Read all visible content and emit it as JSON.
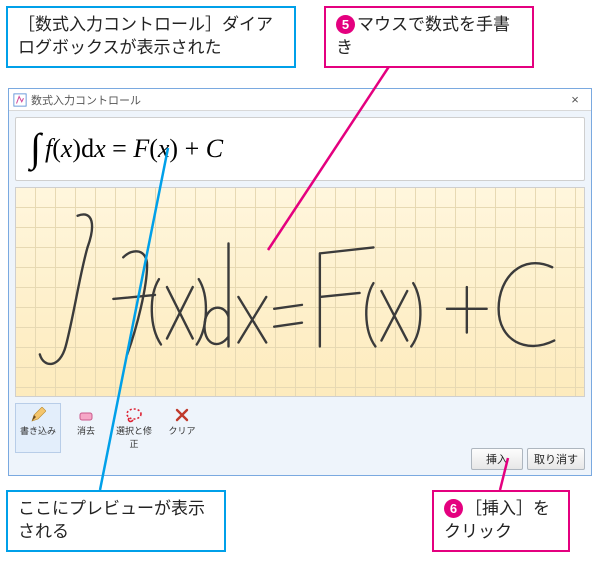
{
  "callouts": {
    "top_left": "［数式入力コントロール］ダイアログボックスが表示された",
    "top_right_num": "5",
    "top_right": "マウスで数式を手書き",
    "bottom_left": "ここにプレビューが表示される",
    "bottom_right_num": "6",
    "bottom_right": "［挿入］をクリック"
  },
  "dialog": {
    "title": "数式入力コントロール",
    "preview_expression": "∫ f(x) dx = F(x) + C",
    "handwriting_expression": "∫ f(x) dx = F(x) + C"
  },
  "tools": {
    "write": "書き込み",
    "erase": "消去",
    "select": "選択と修正",
    "clear": "クリア"
  },
  "buttons": {
    "insert": "挿入",
    "cancel": "取り消す"
  }
}
